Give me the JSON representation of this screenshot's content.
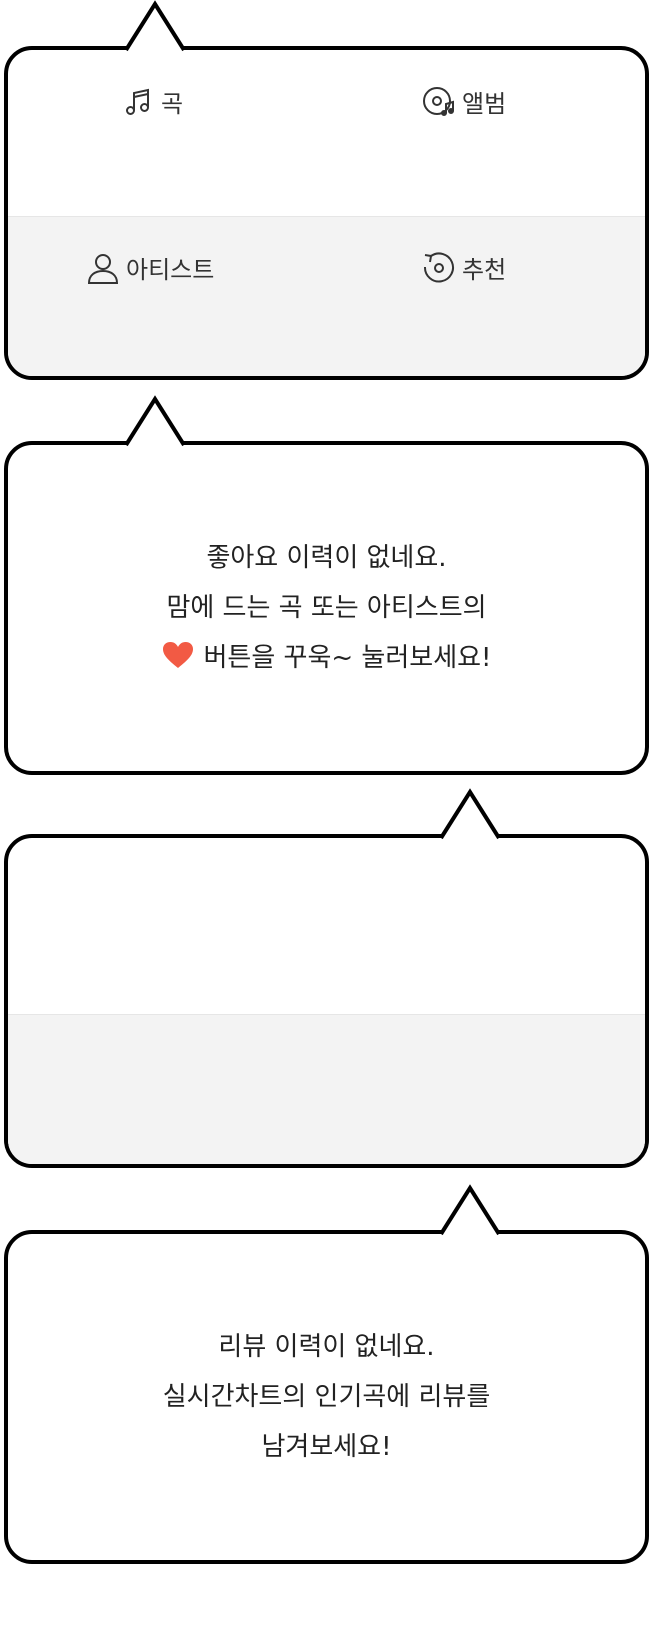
{
  "menu": {
    "song_label": "곡",
    "album_label": "앨범",
    "artist_label": "아티스트",
    "recommend_label": "추천"
  },
  "likes_empty": {
    "line1": "좋아요 이력이 없네요.",
    "line2": "맘에 드는 곡 또는 아티스트의",
    "line3": "버튼을 꾸욱~ 눌러보세요!",
    "heart_icon": "heart-icon",
    "heart_color": "#f25a44"
  },
  "review_empty": {
    "line1": "리뷰 이력이 없네요.",
    "line2": "실시간차트의 인기곡에 리뷰를",
    "line3": "남겨보세요!"
  },
  "colors": {
    "border": "#000000",
    "panel_gray": "#f3f3f3",
    "text": "#222222"
  }
}
